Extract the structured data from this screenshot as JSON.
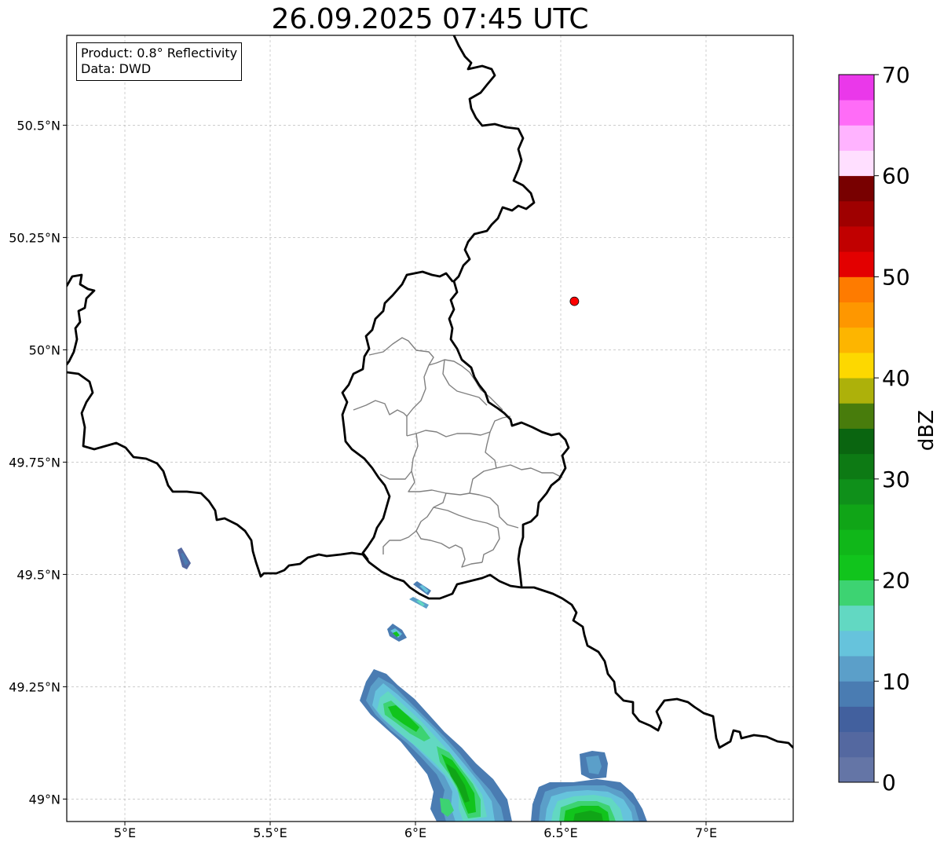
{
  "title": "26.09.2025 07:45 UTC",
  "info": {
    "product": "Product: 0.8° Reflectivity",
    "source": "Data: DWD"
  },
  "map": {
    "lon_range": [
      4.8,
      7.3
    ],
    "lat_range": [
      48.95,
      50.7
    ],
    "lon_ticks": [
      {
        "value": 5.0,
        "label": "5°E"
      },
      {
        "value": 5.5,
        "label": "5.5°E"
      },
      {
        "value": 6.0,
        "label": "6°E"
      },
      {
        "value": 6.5,
        "label": "6.5°E"
      },
      {
        "value": 7.0,
        "label": "7°E"
      }
    ],
    "lat_ticks": [
      {
        "value": 49.0,
        "label": "49°N"
      },
      {
        "value": 49.25,
        "label": "49.25°N"
      },
      {
        "value": 49.5,
        "label": "49.5°N"
      },
      {
        "value": 49.75,
        "label": "49.75°N"
      },
      {
        "value": 50.0,
        "label": "50°N"
      },
      {
        "value": 50.25,
        "label": "50.25°N"
      },
      {
        "value": 50.5,
        "label": "50.5°N"
      }
    ],
    "gridlines": true,
    "marker": {
      "lon": 6.547,
      "lat": 50.108,
      "color": "#ff0000"
    }
  },
  "colorbar": {
    "label": "dBZ",
    "min": 0,
    "max": 70,
    "ticks": [
      {
        "value": 0,
        "label": "0"
      },
      {
        "value": 10,
        "label": "10"
      },
      {
        "value": 20,
        "label": "20"
      },
      {
        "value": 30,
        "label": "30"
      },
      {
        "value": 40,
        "label": "40"
      },
      {
        "value": 50,
        "label": "50"
      },
      {
        "value": 60,
        "label": "60"
      },
      {
        "value": 70,
        "label": "70"
      }
    ],
    "colors": [
      "#6475a6",
      "#5468a0",
      "#42609e",
      "#4a7cb2",
      "#5b9fc9",
      "#66c3dc",
      "#62d8c2",
      "#3dd372",
      "#11c41c",
      "#10b719",
      "#10a517",
      "#0f901a",
      "#0d7a14",
      "#0a6510",
      "#487c0c",
      "#adb10a",
      "#fdd800",
      "#fdb500",
      "#fe9700",
      "#fe7b00",
      "#e30000",
      "#c10000",
      "#9f0000",
      "#780000",
      "#ffdfff",
      "#ffb3ff",
      "#ff6cf7",
      "#ea38ea"
    ]
  }
}
